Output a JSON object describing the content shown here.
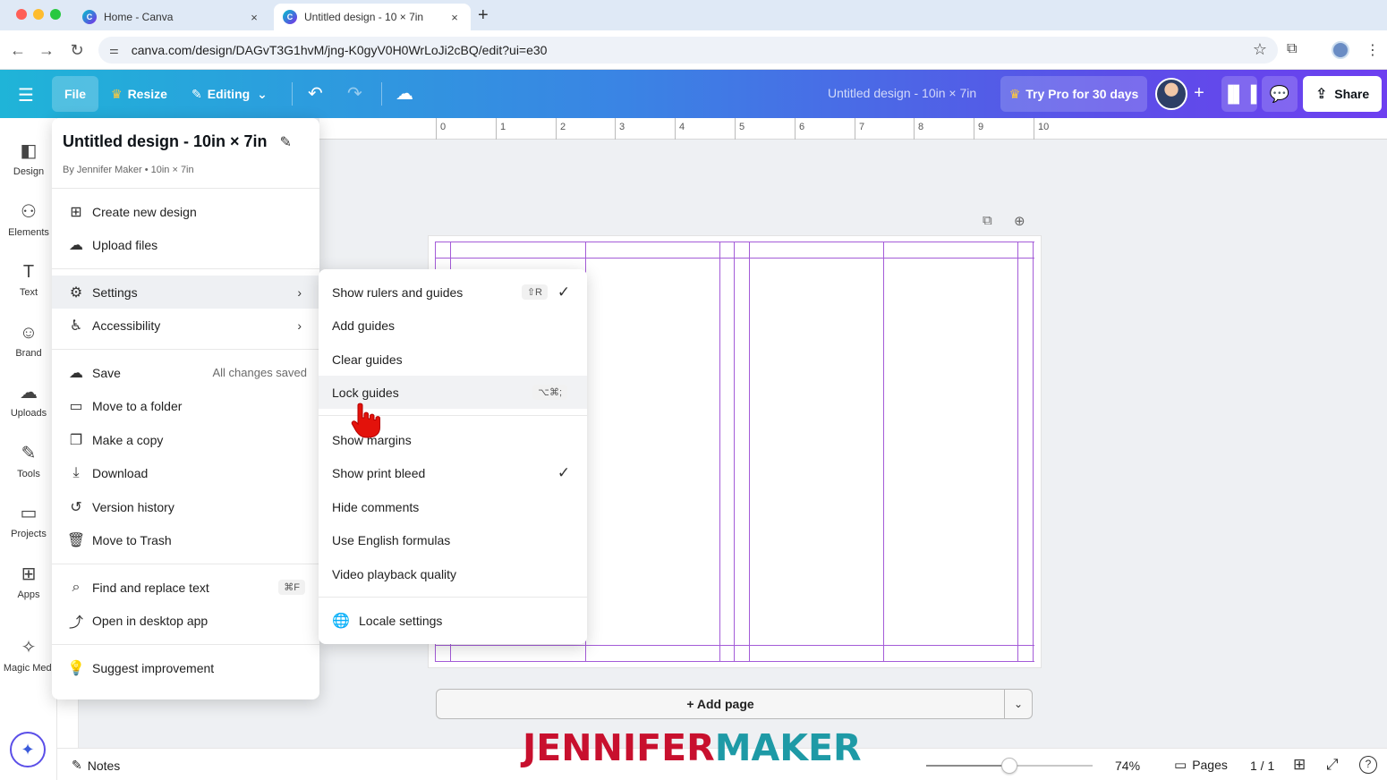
{
  "browser": {
    "tabs": [
      {
        "title": "Home - Canva",
        "close": "×"
      },
      {
        "title": "Untitled design - 10 × 7in",
        "close": "×"
      }
    ],
    "new_tab": "+",
    "url": "canva.com/design/DAGvT3G1hvM/jng-K0gyV0H0WrLoJi2cBQ/edit?ui=e30",
    "back": "←",
    "forward": "→",
    "reload": "↻",
    "star": "☆"
  },
  "header": {
    "menu_icon": "☰",
    "file": "File",
    "resize": "Resize",
    "editing": "Editing",
    "editing_chevron": "⌄",
    "undo": "↶",
    "redo": "↷",
    "cloud": "☁",
    "design_title": "Untitled design - 10in × 7in",
    "try_pro": "Try Pro for 30 days",
    "plus": "+",
    "share": "Share"
  },
  "sidebar": {
    "items": [
      {
        "label": "Design",
        "icon": "◧"
      },
      {
        "label": "Elements",
        "icon": "⚇"
      },
      {
        "label": "Text",
        "icon": "T"
      },
      {
        "label": "Brand",
        "icon": "☺"
      },
      {
        "label": "Uploads",
        "icon": "☁"
      },
      {
        "label": "Tools",
        "icon": "✎"
      },
      {
        "label": "Projects",
        "icon": "▭"
      },
      {
        "label": "Apps",
        "icon": "⊞"
      },
      {
        "label": "Magic Medi",
        "icon": "✧"
      }
    ],
    "magic_icon": "✦"
  },
  "ruler": {
    "labels": [
      "0",
      "1",
      "2",
      "3",
      "4",
      "5",
      "6",
      "7",
      "8",
      "9",
      "10"
    ]
  },
  "file_menu": {
    "title": "Untitled design - 10in × 7in",
    "subtitle": "By Jennifer Maker • 10in × 7in",
    "items": [
      {
        "label": "Create new design",
        "icon": "⊞"
      },
      {
        "label": "Upload files",
        "icon": "☁"
      },
      {
        "label": "Settings",
        "icon": "⚙",
        "chevron": "›"
      },
      {
        "label": "Accessibility",
        "icon": "♿",
        "chevron": "›"
      },
      {
        "label": "Save",
        "icon": "☁",
        "hint": "All changes saved"
      },
      {
        "label": "Move to a folder",
        "icon": "▭"
      },
      {
        "label": "Make a copy",
        "icon": "❐"
      },
      {
        "label": "Download",
        "icon": "⤓"
      },
      {
        "label": "Version history",
        "icon": "↺"
      },
      {
        "label": "Move to Trash",
        "icon": "🗑"
      },
      {
        "label": "Find and replace text",
        "icon": "⌕",
        "shortcut": "⌘F"
      },
      {
        "label": "Open in desktop app",
        "icon": "⤴"
      },
      {
        "label": "Suggest improvement",
        "icon": "💡"
      }
    ]
  },
  "settings_menu": {
    "items": [
      {
        "label": "Show rulers and guides",
        "shortcut": "⇧R",
        "check": "✓"
      },
      {
        "label": "Add guides"
      },
      {
        "label": "Clear guides"
      },
      {
        "label": "Lock guides",
        "shortcut": "⌥⌘;"
      },
      {
        "label": "Show margins"
      },
      {
        "label": "Show print bleed",
        "check": "✓"
      },
      {
        "label": "Hide comments"
      },
      {
        "label": "Use English formulas"
      },
      {
        "label": "Video playback quality"
      },
      {
        "label": "Locale settings",
        "icon": "🌐"
      }
    ]
  },
  "canvas": {
    "add_page": "+ Add page",
    "add_page_chevron": "⌄"
  },
  "bottom": {
    "notes": "Notes",
    "zoom": "74%",
    "zoom_level": 0.5,
    "pages": "Pages",
    "page_count": "1 / 1",
    "help": "?"
  },
  "watermark": {
    "part1": "JENNIFER",
    "part2": "MAKER"
  },
  "colors": {
    "guide": "#a45cd8",
    "accent_start": "#1fb4d8",
    "accent_end": "#6d3ff0",
    "watermark_red": "#c8102e",
    "watermark_teal": "#1e9aa6"
  }
}
